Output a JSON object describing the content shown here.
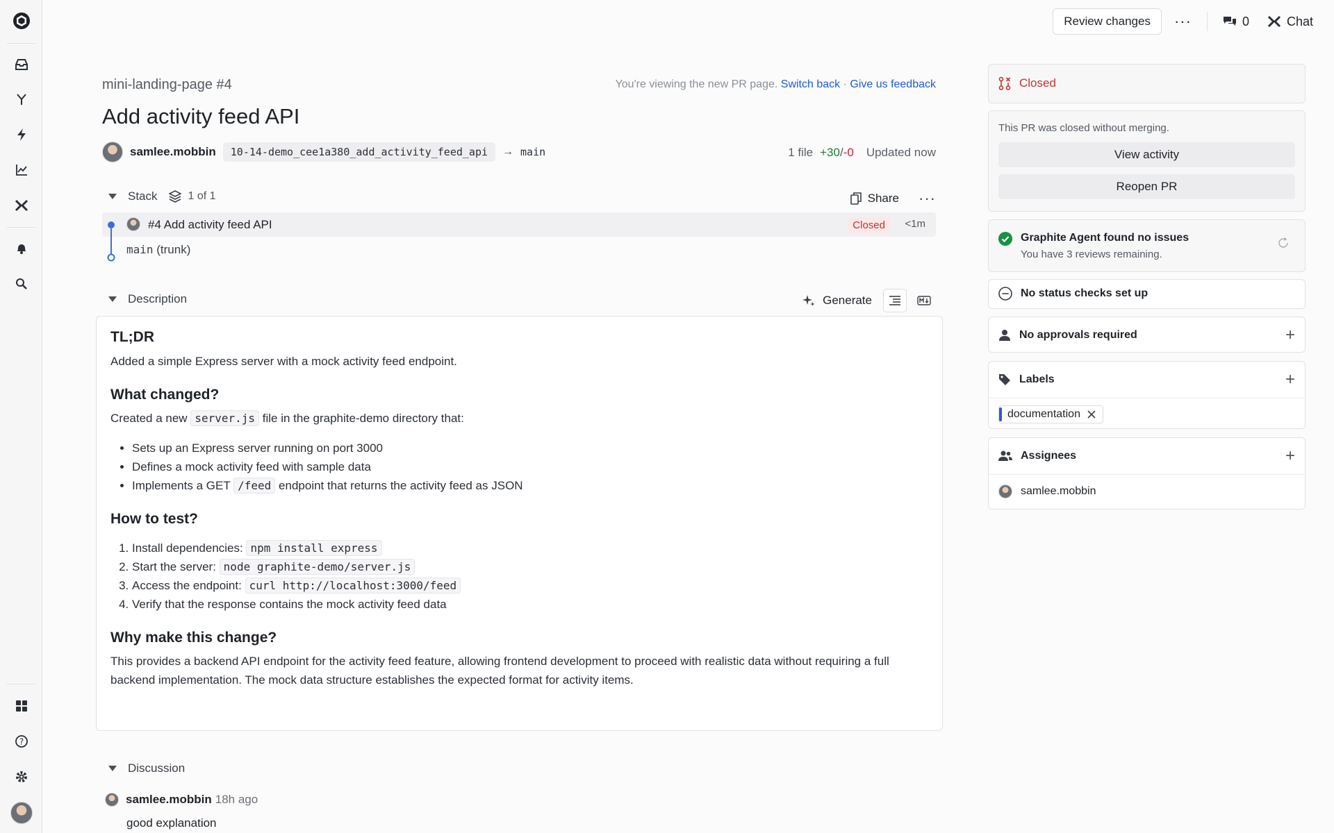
{
  "topbar": {
    "review_label": "Review changes",
    "comments_count": "0",
    "chat_label": "Chat"
  },
  "pr": {
    "repo": "mini-landing-page #4",
    "notice_text": "You're viewing the new PR page.",
    "switch_back": "Switch back",
    "notice_sep": "·",
    "feedback": "Give us feedback",
    "title": "Add activity feed API",
    "author": "samlee.mobbin",
    "branch": "10-14-demo_cee1a380_add_activity_feed_api",
    "target": "main",
    "files": "1 file",
    "additions": "+30",
    "slash": "/",
    "deletions": "-0",
    "updated": "Updated now"
  },
  "stack": {
    "label": "Stack",
    "count": "1 of 1",
    "share": "Share",
    "item_title": "#4 Add activity feed API",
    "item_status": "Closed",
    "item_time": "<1m",
    "trunk_name": "main",
    "trunk_suffix": "(trunk)"
  },
  "description": {
    "label": "Description",
    "generate": "Generate",
    "h_tldr": "TL;DR",
    "tldr": "Added a simple Express server with a mock activity feed endpoint.",
    "h_changed": "What changed?",
    "changed_pre": "Created a new",
    "changed_code": "server.js",
    "changed_post": "file in the graphite-demo directory that:",
    "bullet1": "Sets up an Express server running on port 3000",
    "bullet2": "Defines a mock activity feed with sample data",
    "bullet3_pre": "Implements a GET",
    "bullet3_code": "/feed",
    "bullet3_post": "endpoint that returns the activity feed as JSON",
    "h_test": "How to test?",
    "step1_pre": "Install dependencies:",
    "step1_code": "npm install express",
    "step2_pre": "Start the server:",
    "step2_code": "node graphite-demo/server.js",
    "step3_pre": "Access the endpoint:",
    "step3_code": "curl http://localhost:3000/feed",
    "step4": "Verify that the response contains the mock activity feed data",
    "h_why": "Why make this change?",
    "why": "This provides a backend API endpoint for the activity feed feature, allowing frontend development to proceed with realistic data without requiring a full backend implementation. The mock data structure establishes the expected format for activity items."
  },
  "discussion": {
    "label": "Discussion",
    "author": "samlee.mobbin",
    "time": "18h ago",
    "comment": "good explanation"
  },
  "sidebar": {
    "status": "Closed",
    "closed_msg": "This PR was closed without merging.",
    "view_activity": "View activity",
    "reopen": "Reopen PR",
    "agent_title": "Graphite Agent found no issues",
    "agent_sub": "You have 3 reviews remaining.",
    "checks": "No status checks set up",
    "approvals": "No approvals required",
    "labels_title": "Labels",
    "label_chip": "documentation",
    "assignees_title": "Assignees",
    "assignee": "samlee.mobbin"
  }
}
